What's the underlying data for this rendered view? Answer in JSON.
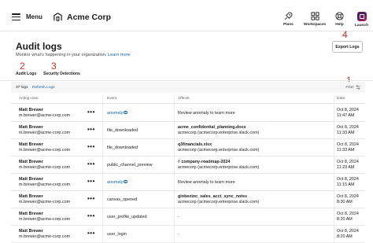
{
  "header": {
    "menu_label": "Menu",
    "workspace_name": "Acme Corp",
    "nav": [
      {
        "label": "Plans",
        "icon": "rocket-icon"
      },
      {
        "label": "Workspaces",
        "icon": "grid-icon"
      },
      {
        "label": "Help",
        "icon": "help-icon"
      },
      {
        "label": "Launch",
        "icon": "launch-icon"
      }
    ]
  },
  "page": {
    "title": "Audit logs",
    "subtitle": "Monitor what's happening in your organization.",
    "learn_more": "Learn more",
    "export_label": "Export Logs"
  },
  "tabs": [
    {
      "label": "Audit Logs",
      "active": true
    },
    {
      "label": "Security Detections",
      "active": false
    }
  ],
  "annotations": {
    "n1": "1",
    "n2": "2",
    "n3": "3",
    "n4": "4"
  },
  "toolbar": {
    "count": "37 logs",
    "refresh": "Refresh Logs",
    "filter": "Filter"
  },
  "table": {
    "headers": {
      "user": "Acting User",
      "event": "Event",
      "affects": "Affects",
      "date": "Date"
    },
    "more_label": "•••",
    "rows": [
      {
        "name": "Matt Brewer",
        "email": "m.brewer@acme-corp.com",
        "event": "anomaly",
        "event_type": "link",
        "affects_main": "Review anomaly to learn more",
        "affects_sub": "",
        "date": "Oct 8, 2024",
        "time": "11:47 AM"
      },
      {
        "name": "Matt Brewer",
        "email": "m.brewer@acme-corp.com",
        "event": "file_downloaded",
        "event_type": "text",
        "affects_main": "acme_confidential_planning.docx",
        "affects_sub": "acmecorp (acmecorp.enterprise.slack.com)",
        "date": "Oct 8, 2024",
        "time": "11:33 AM"
      },
      {
        "name": "Matt Brewer",
        "email": "m.brewer@acme-corp.com",
        "event": "file_downloaded",
        "event_type": "text",
        "affects_main": "q3financials.xlsx",
        "affects_sub": "acmecorp (acmecorp.enterprise.slack.com)",
        "date": "Oct 8, 2024",
        "time": "11:33 AM"
      },
      {
        "name": "Matt Brewer",
        "email": "m.brewer@acme-corp.com",
        "event": "public_channel_preview",
        "event_type": "text",
        "affects_main": "company-roadmap-2024",
        "affects_sub": "acmecorp (acmecorp.enterprise.slack.com)",
        "date": "Oct 8, 2024",
        "time": "11:23 AM"
      },
      {
        "name": "Matt Brewer",
        "email": "m.brewer@acme-corp.com",
        "event": "anomaly",
        "event_type": "link",
        "affects_main": "Review anomaly to learn more",
        "affects_sub": "",
        "date": "Oct 8, 2024",
        "time": "11:15 AM"
      },
      {
        "name": "Matt Brewer",
        "email": "m.brewer@acme-corp.com",
        "event": "canvas_opened",
        "event_type": "text",
        "affects_main": "globexinc_sales_acct_sync_notes",
        "affects_sub": "acmecorp (acmecorp.enterprise.slack.com)",
        "date": "Oct 8, 2024",
        "time": "8:30 AM"
      },
      {
        "name": "Matt Brewer",
        "email": "m.brewer@acme-corp.com",
        "event": "user_profile_updated",
        "event_type": "text",
        "affects_main": "-",
        "affects_sub": "",
        "date": "Oct 8, 2024",
        "time": "8:20 AM"
      },
      {
        "name": "Matt Brewer",
        "email": "m.brewer@acme-corp.com",
        "event": "user_login",
        "event_type": "text",
        "affects_main": "-",
        "affects_sub": "",
        "date": "Oct 8, 2024",
        "time": "8:20 AM"
      }
    ]
  },
  "colors": {
    "accent_link": "#1264a3",
    "annotation": "#d32f2f",
    "text": "#1d1c1d"
  }
}
